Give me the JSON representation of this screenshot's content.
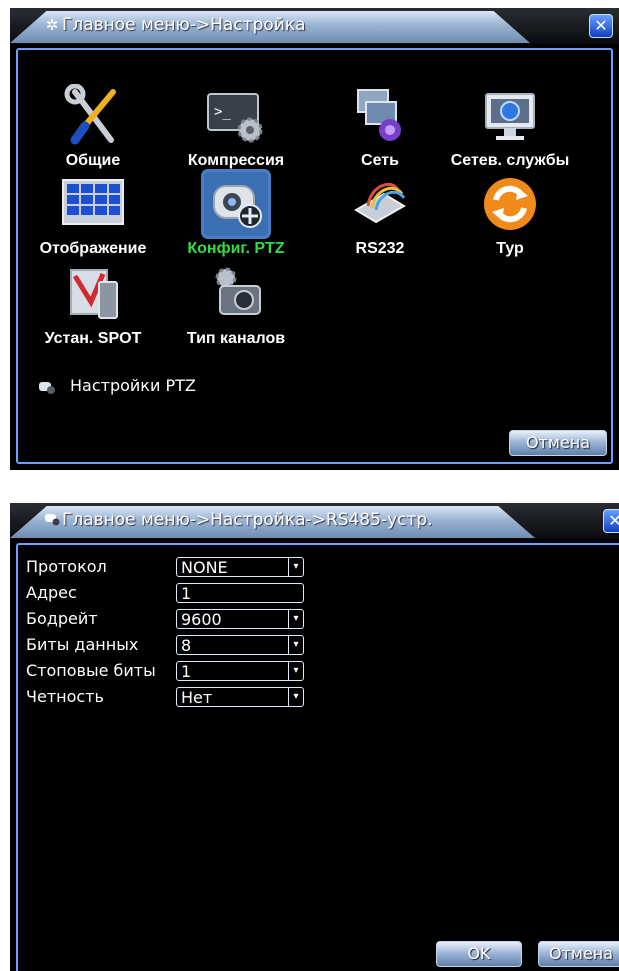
{
  "dialog1": {
    "title": "Главное меню->Настройка",
    "menu": [
      {
        "label": "Общие",
        "icon": "tools-icon"
      },
      {
        "label": "Компрессия",
        "icon": "terminal-gear-icon"
      },
      {
        "label": "Сеть",
        "icon": "network-icon"
      },
      {
        "label": "Сетев. службы",
        "icon": "monitor-globe-icon"
      },
      {
        "label": "Отображение",
        "icon": "grid-display-icon"
      },
      {
        "label": "Конфиг. PTZ",
        "icon": "ptz-camera-icon",
        "active": true
      },
      {
        "label": "RS232",
        "icon": "serial-cable-icon"
      },
      {
        "label": "Тур",
        "icon": "refresh-icon"
      },
      {
        "label": "Устан. SPOT",
        "icon": "spot-icon"
      },
      {
        "label": "Тип каналов",
        "icon": "camera-icon"
      }
    ],
    "hint": "Настройки PTZ",
    "cancel_label": "Отмена"
  },
  "dialog2": {
    "title": "Главное меню->Настройка->RS485-устр.",
    "fields": [
      {
        "label": "Протокол",
        "value": "NONE",
        "dropdown": true
      },
      {
        "label": "Адрес",
        "value": "1",
        "dropdown": false
      },
      {
        "label": "Бодрейт",
        "value": "9600",
        "dropdown": true
      },
      {
        "label": "Биты данных",
        "value": "8",
        "dropdown": true
      },
      {
        "label": "Стоповые биты",
        "value": "1",
        "dropdown": true
      },
      {
        "label": "Четность",
        "value": "Нет",
        "dropdown": true
      }
    ],
    "ok_label": "OK",
    "cancel_label": "Отмена"
  },
  "colors": {
    "accent": "#6da0ff",
    "active_label": "#33dd44"
  }
}
